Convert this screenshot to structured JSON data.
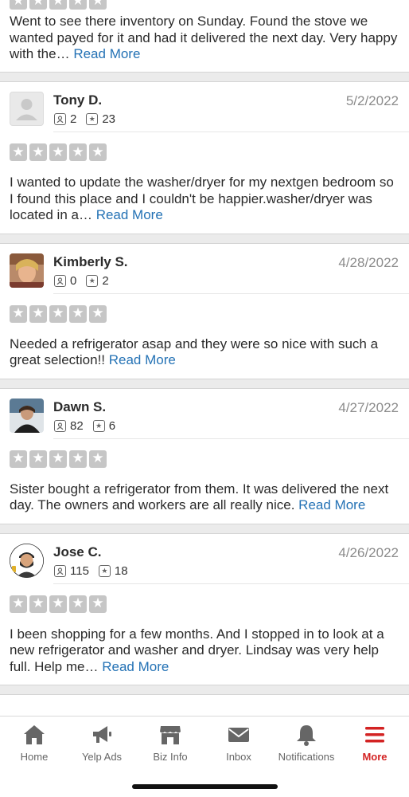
{
  "partial_review": {
    "text": "Went to see there inventory on Sunday. Found the stove we wanted payed for it and had it delivered the next day. Very happy with the…",
    "read_more": "Read More"
  },
  "reviews": [
    {
      "name": "Tony D.",
      "date": "5/2/2022",
      "reviews_count": "2",
      "photos_count": "23",
      "rating": 5,
      "avatar": "default-avatar",
      "text": "I wanted to update the  washer/dryer for my nextgen bedroom so I found this place and I couldn't be happier.washer/dryer was located in a…",
      "read_more": "Read More"
    },
    {
      "name": "Kimberly S.",
      "date": "4/28/2022",
      "reviews_count": "0",
      "photos_count": "2",
      "rating": 5,
      "avatar": "photo",
      "text": "Needed a refrigerator asap and they were so nice with such a great selection!!",
      "read_more": "Read More"
    },
    {
      "name": "Dawn S.",
      "date": "4/27/2022",
      "reviews_count": "82",
      "photos_count": "6",
      "rating": 5,
      "avatar": "photo",
      "text": "Sister bought a refrigerator from them. It was delivered the next day. The owners and workers are all really nice.",
      "read_more": "Read More"
    },
    {
      "name": "Jose C.",
      "date": "4/26/2022",
      "reviews_count": "115",
      "photos_count": "18",
      "rating": 5,
      "avatar": "photo",
      "text": "I been shopping for a few months. And I stopped in to look at a new refrigerator and washer and dryer. Lindsay was very help full. Help me…",
      "read_more": "Read More"
    }
  ],
  "tabbar": {
    "tabs": [
      {
        "label": "Home",
        "icon": "home-icon"
      },
      {
        "label": "Yelp Ads",
        "icon": "megaphone-icon"
      },
      {
        "label": "Biz Info",
        "icon": "storefront-icon"
      },
      {
        "label": "Inbox",
        "icon": "envelope-icon"
      },
      {
        "label": "Notifications",
        "icon": "bell-icon"
      },
      {
        "label": "More",
        "icon": "menu-icon",
        "active": true
      }
    ]
  },
  "colors": {
    "link": "#2472b5",
    "active_tab": "#d32323",
    "star_empty": "#c6c6c6"
  }
}
